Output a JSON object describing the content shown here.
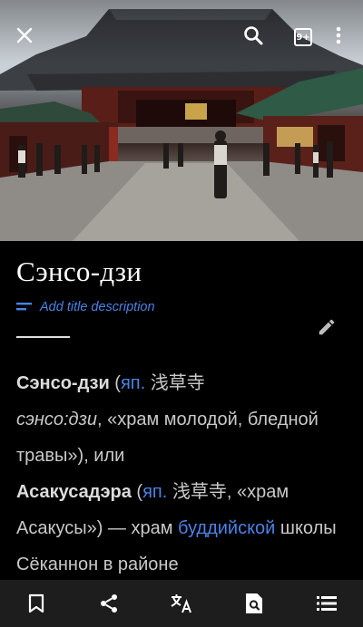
{
  "toolbar": {
    "close_icon": "close-icon",
    "search_icon": "search-icon",
    "tabs_count": "9+",
    "more_icon": "more-vert-icon"
  },
  "article": {
    "title": "Сэнсо-дзи",
    "add_description": "Add title description",
    "para": {
      "bold1": "Сэнсо-дзи",
      "open1": " (",
      "link_jp1": "яп.",
      "kanji1": " 浅草寺",
      "italic1": "сэнсо:дзи",
      "text1": ", «храм молодой, бледной травы»), или ",
      "bold2": "Асакусадэра",
      "open2": " (",
      "link_jp2": "яп.",
      "kanji2": " 浅草寺",
      "text2": ", «храм Асакусы») — храм ",
      "link_buddhist": "буддийской",
      "text3": " школы Сёканнон в районе"
    }
  },
  "bottom_bar": [
    "bookmark-icon",
    "share-icon",
    "translate-icon",
    "find-in-page-icon",
    "contents-icon"
  ],
  "colors": {
    "background": "#000000",
    "link": "#4b82e6",
    "bottom_bar": "#1d1d1d"
  }
}
